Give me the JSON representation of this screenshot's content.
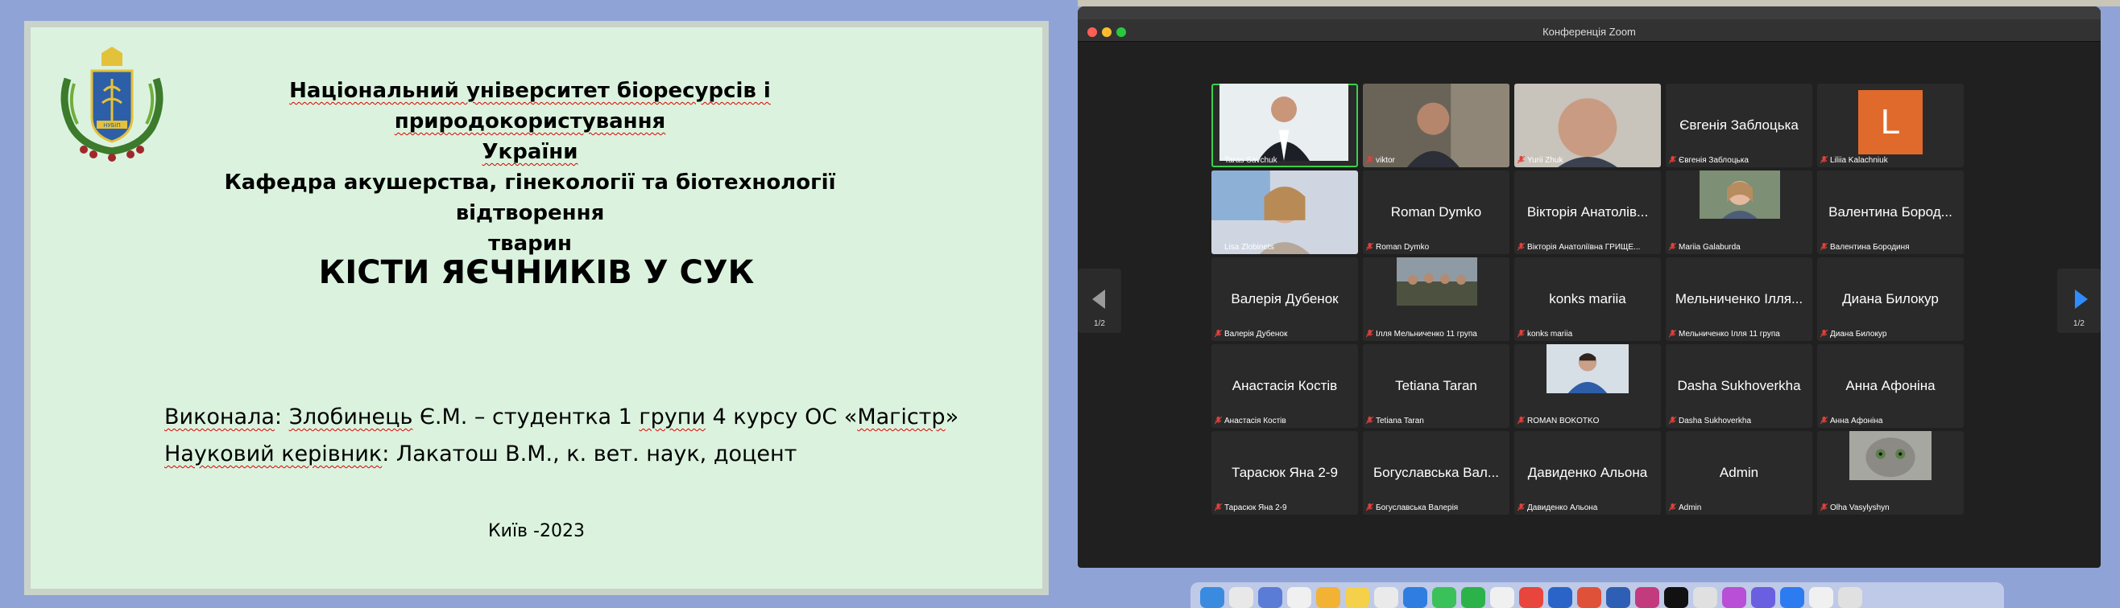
{
  "slide": {
    "university_line1": "Національний університет біоресурсів і природокористування",
    "university_line2": "України",
    "department_line1": "Кафедра акушерства, гінекології та біотехнології відтворення",
    "department_line2": "тварин",
    "title": "КІСТИ ЯЄЧНИКІВ У СУК",
    "author_label": "Виконала",
    "author_surname": "Злобинець",
    "author_rest": " Є.М. – студентка 1 ",
    "group_word": "групи",
    "author_tail": " 4 курсу ОС «",
    "degree_word": "Магістр",
    "author_end": "»",
    "supervisor_label": "Науковий керівник",
    "supervisor_colon": ": Лакатош В.М., к. вет. наук, доцент",
    "city_year": "Київ -2023",
    "crest_text": "НУБіП"
  },
  "zoom": {
    "window_title": "Конференція Zoom",
    "page_left": "1/2",
    "page_right": "1/2",
    "accent_active": "#3cd14a",
    "participants": [
      {
        "label": "Taras Savchuk",
        "big": "",
        "video": "man-suit",
        "active": true
      },
      {
        "label": "viktor",
        "big": "",
        "video": "man-glasses",
        "muted": true
      },
      {
        "label": "Yurii Zhuk",
        "big": "",
        "video": "man-closeup",
        "muted": true
      },
      {
        "label": "Євгенія Заблоцька",
        "big": "Євгенія Заблоцька",
        "muted": true
      },
      {
        "label": "Liliia Kalachniuk",
        "big": "",
        "avatar": "L",
        "muted": true
      },
      {
        "label": "Lisa Zlobinets",
        "big": "",
        "video": "woman-room"
      },
      {
        "label": "Roman Dymko",
        "big": "Roman Dymko",
        "muted": true
      },
      {
        "label": "Вікторія Анатоліївна ГРИЩЕ...",
        "big": "Вікторія Анатолів...",
        "muted": true
      },
      {
        "label": "Mariia Galaburda",
        "big": "",
        "video": "woman-smile",
        "muted": true
      },
      {
        "label": "Валентина Бородиня",
        "big": "Валентина Бород...",
        "muted": true
      },
      {
        "label": "Валерія Дубенок",
        "big": "Валерія Дубенок",
        "muted": true
      },
      {
        "label": "Ілля Мельниченко 11 група",
        "big": "",
        "video": "group-soldiers",
        "muted": true
      },
      {
        "label": "konks mariia",
        "big": "konks mariia",
        "muted": true
      },
      {
        "label": "Мельниченко Ілля 11 група",
        "big": "Мельниченко Ілля...",
        "muted": true
      },
      {
        "label": "Диана Билокур",
        "big": "Диана Билокур",
        "muted": true
      },
      {
        "label": "Анастасія Костів",
        "big": "Анастасія Костів",
        "muted": true
      },
      {
        "label": "Tetiana Taran",
        "big": "Tetiana Taran",
        "muted": true
      },
      {
        "label": "ROMAN BOKOTKO",
        "big": "",
        "video": "man-blue",
        "muted": true
      },
      {
        "label": "Dasha Sukhoverkha",
        "big": "Dasha Sukhoverkha",
        "muted": true
      },
      {
        "label": "Анна Афоніна",
        "big": "Анна Афоніна",
        "muted": true
      },
      {
        "label": "Тарасюк Яна 2-9",
        "big": "Тарасюк Яна 2-9",
        "muted": true
      },
      {
        "label": "Богуславська Валерія",
        "big": "Богуславська Вал...",
        "muted": true
      },
      {
        "label": "Давиденко Альона",
        "big": "Давиденко Альона",
        "muted": true
      },
      {
        "label": "Admin",
        "big": "Admin",
        "muted": true
      },
      {
        "label": "Olha Vasylyshyn",
        "big": "",
        "video": "cat",
        "muted": true
      }
    ]
  }
}
